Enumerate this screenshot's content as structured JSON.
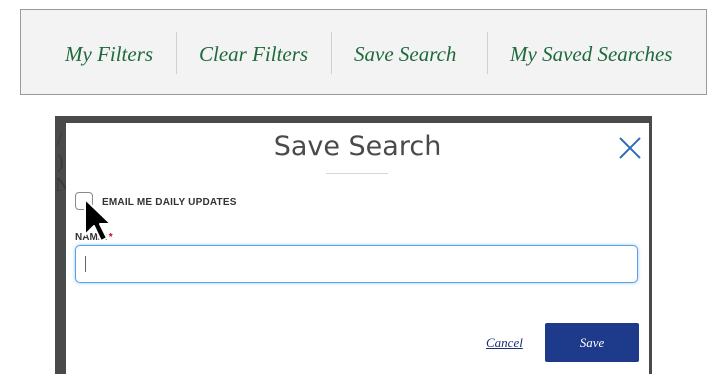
{
  "filter_bar": {
    "items": [
      "My Filters",
      "Clear Filters",
      "Save Search",
      "My Saved Searches"
    ]
  },
  "background": {
    "fragments": [
      "/",
      ")",
      "N"
    ]
  },
  "modal": {
    "title": "Save Search",
    "close_icon": "close-icon",
    "checkbox_label": "EMAIL ME DAILY UPDATES",
    "checkbox_checked": false,
    "name_label": "NAME:",
    "required_mark": "*",
    "name_value": "",
    "cancel_label": "Cancel",
    "save_label": "Save"
  },
  "colors": {
    "filter_link": "#1f6a3c",
    "save_button": "#1e3a8a",
    "input_focus_border": "#5aa0e8",
    "required": "#d0021b"
  }
}
